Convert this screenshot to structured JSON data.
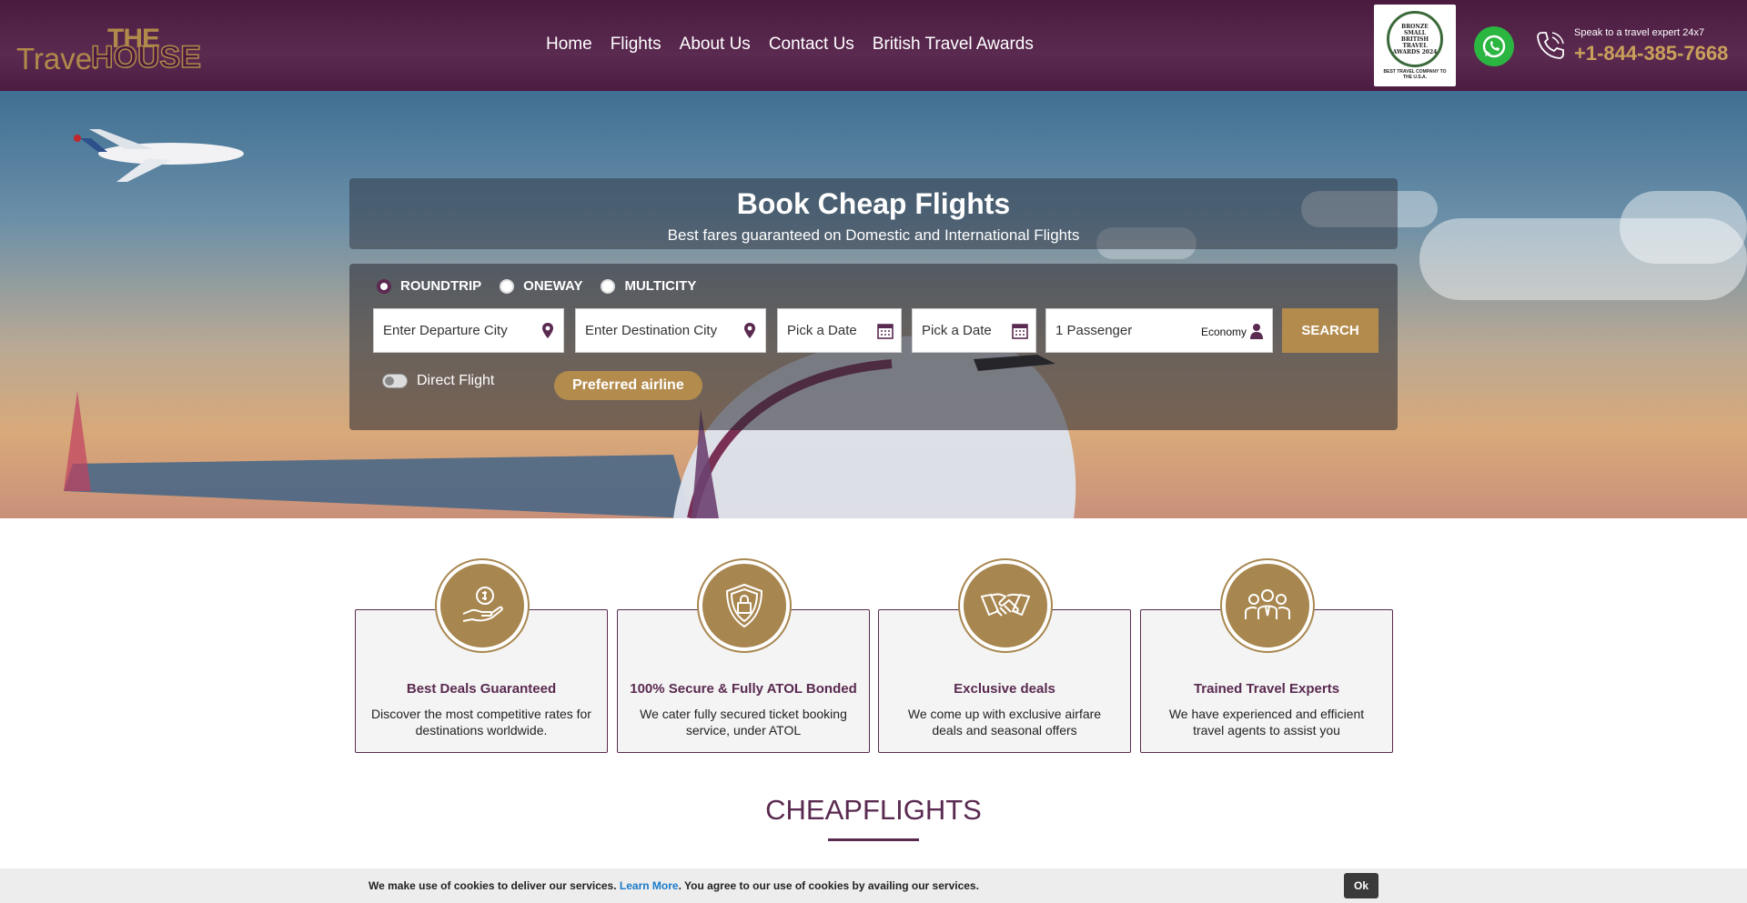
{
  "header": {
    "logo_the": "THE",
    "logo_travel": "Travel",
    "logo_house": "HOUSE",
    "nav": [
      "Home",
      "Flights",
      "About Us",
      "Contact Us",
      "British Travel Awards"
    ],
    "award": {
      "line1": "BRONZE SMALL BRITISH TRAVEL AWARDS 2024",
      "line2": "BEST TRAVEL COMPANY TO THE U.S.A."
    },
    "phone_label": "Speak to a travel expert 24x7",
    "phone_number": "+1-844-385-7668"
  },
  "hero": {
    "title": "Book Cheap Flights",
    "subtitle": "Best fares guaranteed on Domestic and International Flights",
    "trip_types": [
      "ROUNDTRIP",
      "ONEWAY",
      "MULTICITY"
    ],
    "selected_trip": "ROUNDTRIP",
    "departure_placeholder": "Enter Departure City",
    "destination_placeholder": "Enter Destination City",
    "depart_date_placeholder": "Pick a Date",
    "return_date_placeholder": "Pick a Date",
    "passengers": "1 Passenger",
    "cabin_class": "Economy",
    "search_label": "SEARCH",
    "direct_flight_label": "Direct Flight",
    "preferred_airline_label": "Preferred airline"
  },
  "features": [
    {
      "title": "Best Deals Guaranteed",
      "text": "Discover the most competitive rates for destinations worldwide.",
      "icon": "hand-money-icon"
    },
    {
      "title": "100% Secure & Fully ATOL Bonded",
      "text": "We cater fully secured ticket booking service, under ATOL",
      "icon": "shield-lock-icon"
    },
    {
      "title": "Exclusive deals",
      "text": "We come up with exclusive airfare deals and seasonal offers",
      "icon": "handshake-icon"
    },
    {
      "title": "Trained Travel Experts",
      "text": "We have experienced and efficient travel agents to assist you",
      "icon": "team-icon"
    }
  ],
  "section_title": "CHEAPFLIGHTS",
  "cookie": {
    "text_before": "We make use of cookies to deliver our services. ",
    "link": "Learn More",
    "text_after": ". You agree to our use of cookies by availing our services.",
    "ok_label": "Ok"
  },
  "colors": {
    "brand_purple": "#5a2a50",
    "brand_gold": "#b38b4d",
    "whatsapp_green": "#2bb541"
  }
}
